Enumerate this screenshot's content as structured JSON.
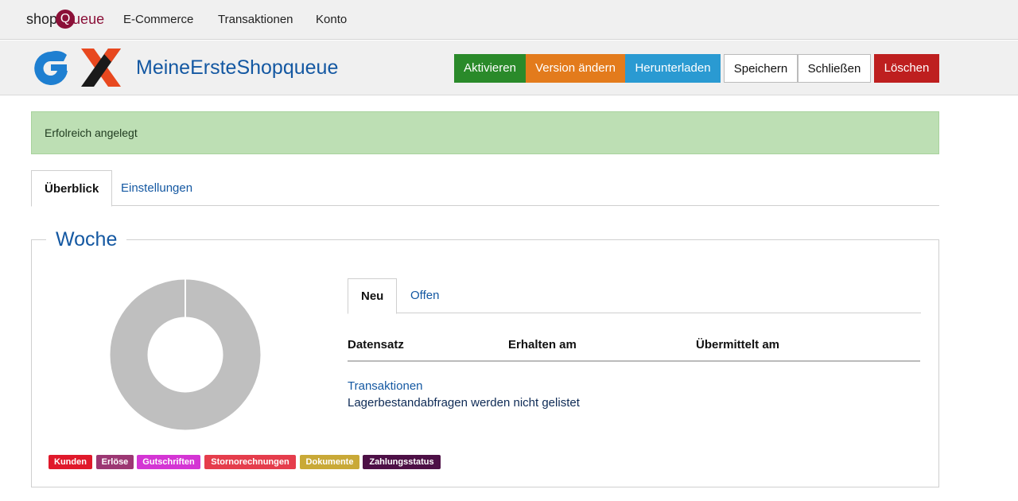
{
  "topnav": {
    "brand_pre": "shop",
    "brand_q": "Q",
    "brand_post": "ueue",
    "links": [
      "E-Commerce",
      "Transaktionen",
      "Konto"
    ]
  },
  "header": {
    "title": "MeineErsteShopqueue",
    "buttons": {
      "activate": "Aktivieren",
      "change_version": "Version ändern",
      "download": "Herunterladen",
      "save": "Speichern",
      "close": "Schließen",
      "delete": "Löschen"
    }
  },
  "alert": {
    "text": "Erfolreich angelegt"
  },
  "tabs": {
    "overview": "Überblick",
    "settings": "Einstellungen"
  },
  "panel": {
    "legend": "Woche",
    "chart_colors": {
      "ring": "#bfbfbf"
    },
    "badges": [
      {
        "label": "Kunden",
        "color": "#e0192b"
      },
      {
        "label": "Erlöse",
        "color": "#9c3773"
      },
      {
        "label": "Gutschriften",
        "color": "#d435d4"
      },
      {
        "label": "Stornorechnungen",
        "color": "#e53d4c"
      },
      {
        "label": "Dokumente",
        "color": "#c9a937"
      },
      {
        "label": "Zahlungsstatus",
        "color": "#4d1046"
      }
    ],
    "inner_tabs": {
      "new": "Neu",
      "open": "Offen"
    },
    "table": {
      "columns": [
        "Datensatz",
        "Erhalten am",
        "Übermittelt am"
      ],
      "link": "Transaktionen",
      "note": "Lagerbestandabfragen werden nicht gelistet"
    }
  }
}
